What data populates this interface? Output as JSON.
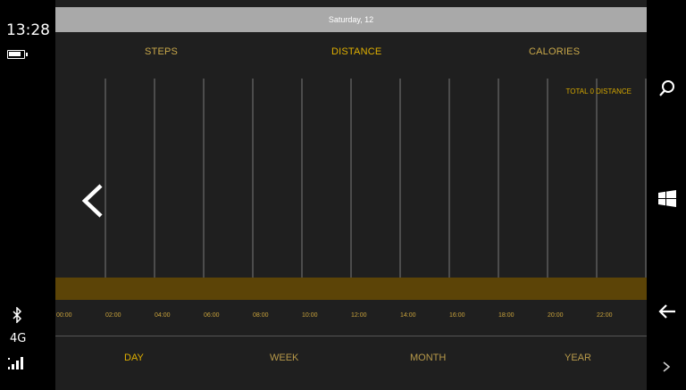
{
  "status": {
    "time": "13:28",
    "network": "4G"
  },
  "header": {
    "date": "Saturday, 12"
  },
  "metric_tabs": [
    {
      "id": "steps",
      "label": "STEPS"
    },
    {
      "id": "distance",
      "label": "DISTANCE",
      "selected": true
    },
    {
      "id": "calories",
      "label": "CALORIES"
    }
  ],
  "chart": {
    "total_label": "TOTAL 0 DISTANCE"
  },
  "hours": [
    "00:00",
    "02:00",
    "04:00",
    "06:00",
    "08:00",
    "10:00",
    "12:00",
    "14:00",
    "16:00",
    "18:00",
    "20:00",
    "22:00"
  ],
  "range_tabs": [
    {
      "id": "day",
      "label": "DAY",
      "selected": true
    },
    {
      "id": "week",
      "label": "WEEK"
    },
    {
      "id": "month",
      "label": "MONTH"
    },
    {
      "id": "year",
      "label": "YEAR"
    }
  ],
  "chart_data": {
    "type": "bar",
    "categories": [
      "00:00",
      "02:00",
      "04:00",
      "06:00",
      "08:00",
      "10:00",
      "12:00",
      "14:00",
      "16:00",
      "18:00",
      "20:00",
      "22:00"
    ],
    "values": [
      0,
      0,
      0,
      0,
      0,
      0,
      0,
      0,
      0,
      0,
      0,
      0
    ],
    "title": "",
    "xlabel": "",
    "ylabel": "",
    "grid": true
  },
  "colors": {
    "accent": "#e0b000",
    "bar_fill": "#5c4407",
    "date_bar": "#a9a9a9",
    "app_background": "#1f1f1f"
  },
  "icons": {
    "battery": "battery-icon",
    "bluetooth": "bluetooth-icon",
    "signal": "signal-icon",
    "prev": "chevron-left-icon",
    "search": "search-icon",
    "start": "windows-icon",
    "back": "back-arrow-icon",
    "more": "chevron-right-icon"
  }
}
